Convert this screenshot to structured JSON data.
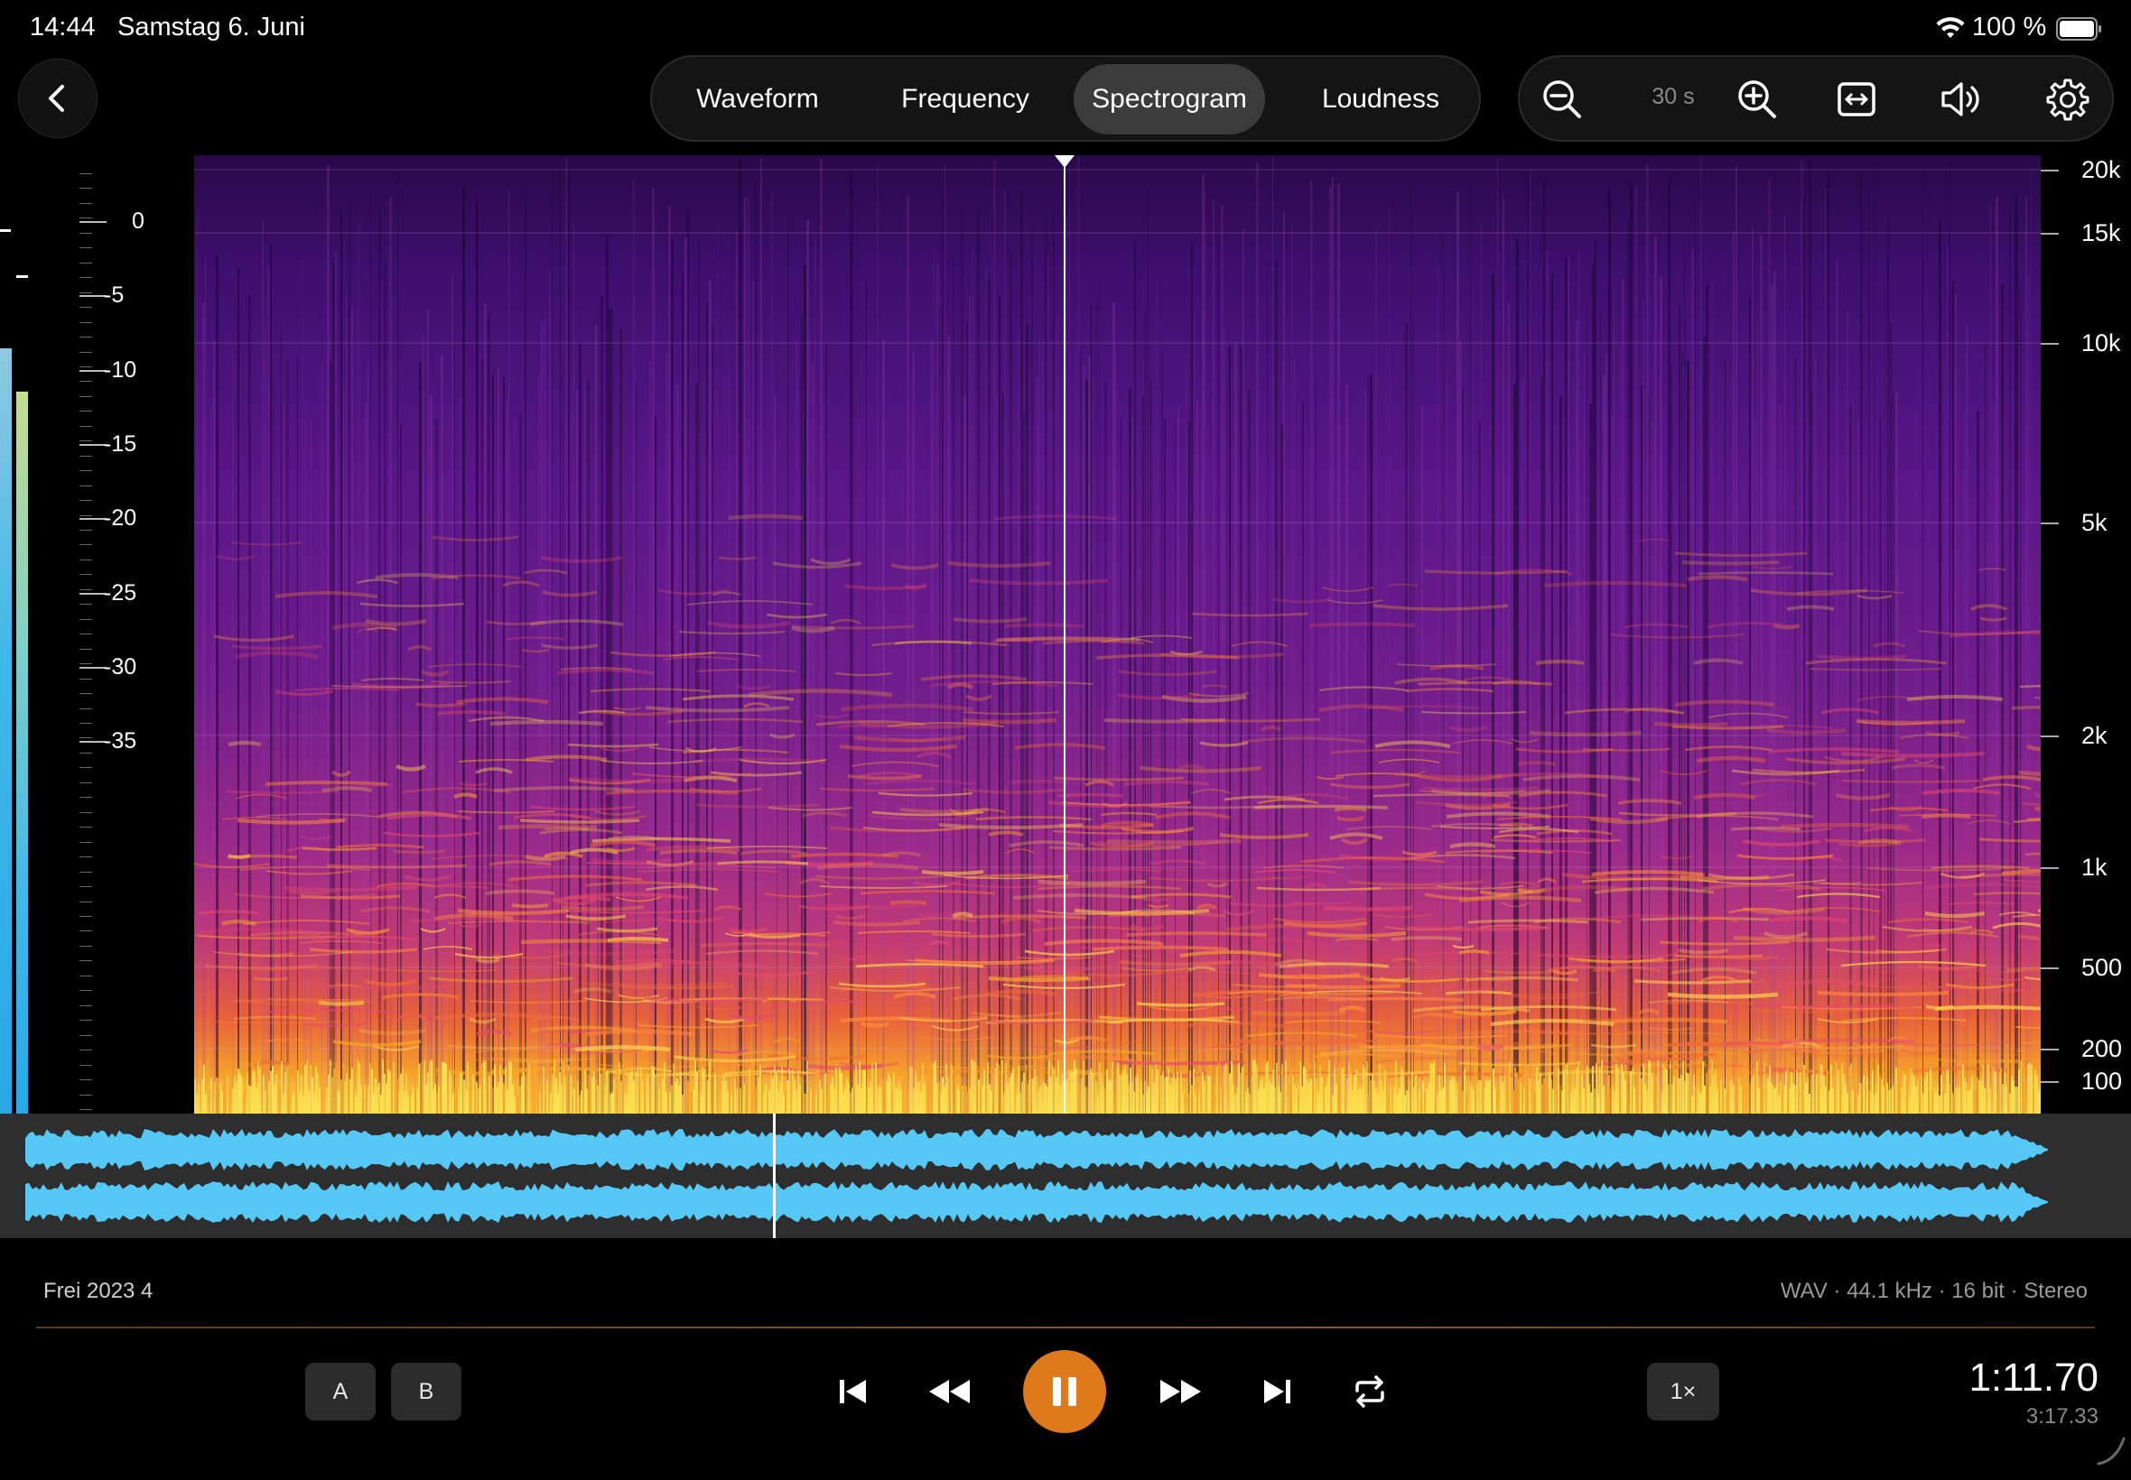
{
  "status_bar": {
    "time": "14:44",
    "date": "Samstag 6. Juni",
    "battery_percent": "100 %",
    "wifi_icon": "wifi-icon",
    "battery_icon": "battery-full-icon"
  },
  "header": {
    "back_icon": "chevron-left-icon",
    "tabs": [
      {
        "label": "Waveform",
        "active": false
      },
      {
        "label": "Frequency",
        "active": false
      },
      {
        "label": "Spectrogram",
        "active": true
      },
      {
        "label": "Loudness",
        "active": false
      }
    ],
    "toolbar": {
      "zoom_out_icon": "zoom-out-icon",
      "zoom_level": "30 s",
      "zoom_in_icon": "zoom-in-icon",
      "fit_icon": "fit-width-icon",
      "volume_icon": "speaker-icon",
      "settings_icon": "gear-icon"
    }
  },
  "level_meter": {
    "db_labels": [
      "0",
      "-5",
      "-10",
      "-15",
      "-20",
      "-25",
      "-30",
      "-35"
    ],
    "colors": {
      "left": "#3fb8ea",
      "right_top": "#b7d98a"
    }
  },
  "spectrogram": {
    "freq_labels": [
      "20k",
      "15k",
      "10k",
      "5k",
      "2k",
      "1k",
      "500",
      "200",
      "100"
    ],
    "colormap": [
      "#000000",
      "#2a0a4a",
      "#5a1a8a",
      "#8a2a9a",
      "#c0308a",
      "#e85a3a",
      "#f5a020",
      "#fde050"
    ]
  },
  "overview": {
    "waveform_color": "#55c8f5"
  },
  "track": {
    "title": "Frei 2023 4",
    "format": "WAV · 44.1 kHz · 16 bit · Stereo"
  },
  "transport": {
    "a_label": "A",
    "b_label": "B",
    "skip_back_icon": "skip-back-icon",
    "rewind_icon": "rewind-icon",
    "pause_icon": "pause-icon",
    "fast_forward_icon": "fast-forward-icon",
    "skip_forward_icon": "skip-forward-icon",
    "repeat_icon": "repeat-icon",
    "speed_label": "1×",
    "current_time": "1:11.70",
    "total_time": "3:17.33",
    "accent_color": "#de7a1c"
  }
}
